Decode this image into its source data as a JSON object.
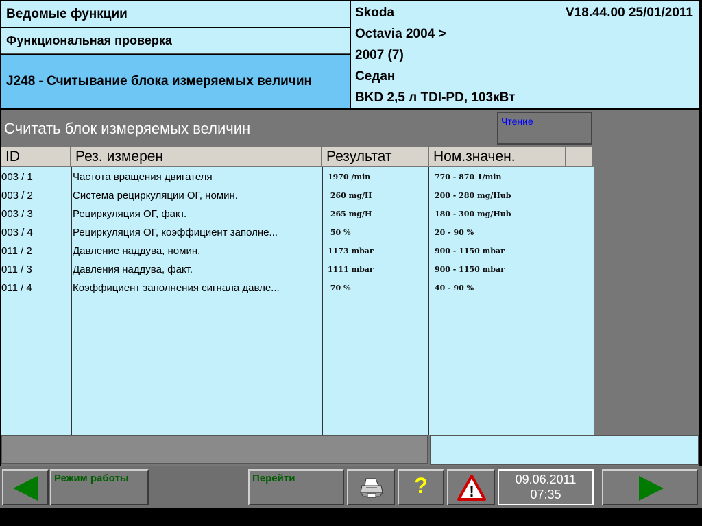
{
  "header": {
    "left": {
      "line1": "Ведомые функции",
      "line2": "Функциональная проверка",
      "line3": "J248 - Считывание блока измеряемых величин"
    },
    "right": {
      "make": "Skoda",
      "version": "V18.44.00 25/01/2011",
      "model": "Octavia 2004 >",
      "year": "2007 (7)",
      "body": "Седан",
      "engine": "BKD 2,5 л TDI-PD, 103кВт"
    }
  },
  "section": {
    "title": "Считать блок измеряемых величин",
    "status": "Чтение"
  },
  "table": {
    "headers": [
      "ID",
      "Рез. измерен",
      "Результат",
      "Ном.значен."
    ],
    "rows": [
      {
        "id": "003 / 1",
        "name": "Частота вращения двигателя",
        "result": "1970 /min",
        "nominal": "770 - 870 1/min"
      },
      {
        "id": "003 / 2",
        "name": "Система рециркуляции ОГ, номин.",
        "result": " 260 mg/H",
        "nominal": "200 - 280 mg/Hub"
      },
      {
        "id": "003 / 3",
        "name": "Рециркуляция ОГ, факт.",
        "result": " 265 mg/H",
        "nominal": "180 - 300 mg/Hub"
      },
      {
        "id": "003 / 4",
        "name": "Рециркуляция ОГ, коэффициент заполне...",
        "result": " 50 %",
        "nominal": "20 - 90 %"
      },
      {
        "id": "011 / 2",
        "name": "Давление наддува, номин.",
        "result": "1173 mbar",
        "nominal": "900 - 1150 mbar"
      },
      {
        "id": "011 / 3",
        "name": "Давления наддува, факт.",
        "result": "1111 mbar",
        "nominal": "900 - 1150 mbar"
      },
      {
        "id": "011 / 4",
        "name": "Коэффициент заполнения сигнала давле...",
        "result": " 70 %",
        "nominal": "40 - 90 %"
      }
    ]
  },
  "footer": {
    "mode_label": "Режим работы",
    "goto_label": "Перейти",
    "help_symbol": "?",
    "warning_symbol": "!",
    "date": "09.06.2011",
    "time": "07:35"
  },
  "colors": {
    "panel": "#c4f0fc",
    "highlight": "#6ec6f5",
    "nav_arrow": "#007a00",
    "status_text": "#0000ff"
  }
}
